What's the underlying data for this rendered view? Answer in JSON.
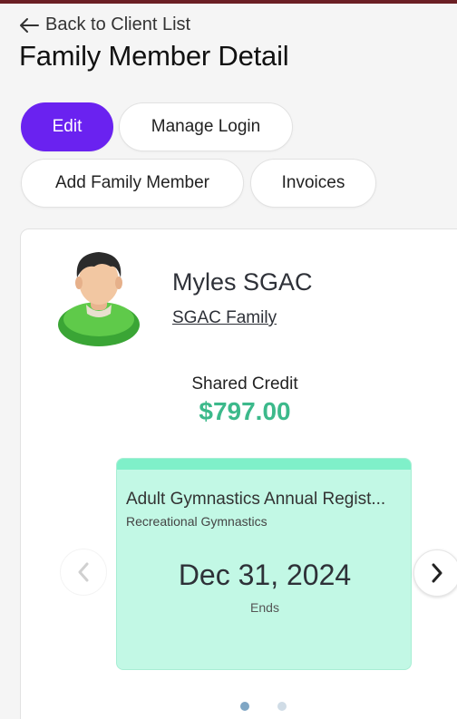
{
  "header": {
    "back_label": "Back to Client List",
    "title": "Family Member Detail"
  },
  "actions": {
    "edit": "Edit",
    "manage_login": "Manage Login",
    "add_family_member": "Add Family Member",
    "invoices": "Invoices"
  },
  "member": {
    "name": "Myles SGAC",
    "family": "SGAC Family",
    "avatar_icon": "person-avatar-icon"
  },
  "credit": {
    "label": "Shared Credit",
    "value": "$797.00"
  },
  "registration": {
    "title": "Adult Gymnastics Annual Regist...",
    "subtitle": "Recreational Gymnastics",
    "date": "Dec 31, 2024",
    "date_label": "Ends"
  },
  "carousel": {
    "current_page": 1,
    "total_pages": 2,
    "prev_icon": "chevron-left-icon",
    "next_icon": "chevron-right-icon"
  },
  "colors": {
    "primary": "#6a22f0",
    "credit": "#3cb98b",
    "registration_card": "#c2f8e5",
    "registration_accent": "#7ff0c9",
    "top_strip": "#6b1f24"
  }
}
